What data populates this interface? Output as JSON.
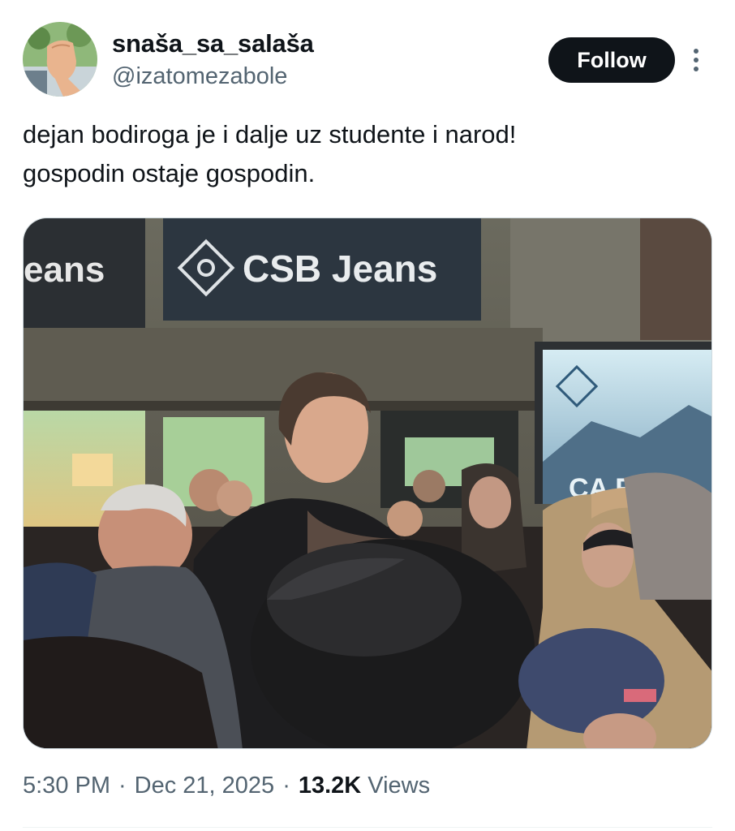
{
  "author": {
    "display_name": "snaša_sa_salaša",
    "handle": "@izatomezabole",
    "avatar_icon": "raised-fist-avatar"
  },
  "header": {
    "follow_label": "Follow",
    "more_icon": "more-vertical-icon"
  },
  "tweet": {
    "text_lines": [
      "dejan bodiroga je i dalje uz studente i narod!",
      "gospodin ostaje gospodin."
    ]
  },
  "photo": {
    "store_sign_left": "eans",
    "store_sign_main": "CSB Jeans",
    "poster_text": "CA    RA"
  },
  "meta": {
    "time": "5:30 PM",
    "separator": "·",
    "date": "Dec 21, 2025",
    "views_count": "13.2K",
    "views_label": "Views"
  },
  "colors": {
    "text": "#0f1419",
    "secondary": "#536471",
    "button_bg": "#0f1419",
    "button_text": "#ffffff",
    "divider": "#eff3f4"
  }
}
